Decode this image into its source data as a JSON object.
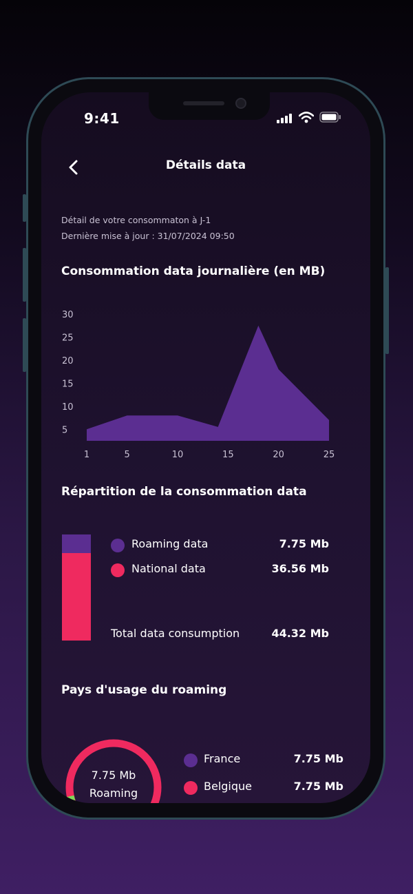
{
  "status_bar": {
    "time": "9:41"
  },
  "header": {
    "title": "Détails data"
  },
  "info": {
    "line1": "Détail de votre consommaton à J-1",
    "line2": "Dernière mise à jour : 31/07/2024 09:50"
  },
  "daily_section": {
    "title": "Consommation data journalière (en MB)"
  },
  "chart_data": {
    "type": "area",
    "title": "Consommation data journalière (en MB)",
    "x": [
      1,
      5,
      10,
      14,
      18,
      20,
      25
    ],
    "values": [
      5,
      8,
      8,
      5.5,
      27.5,
      18,
      7
    ],
    "xticks": [
      "1",
      "5",
      "10",
      "15",
      "20",
      "25"
    ],
    "yticks": [
      "30",
      "25",
      "20",
      "15",
      "10",
      "5"
    ],
    "ylim": [
      2.5,
      30
    ],
    "xlim": [
      1,
      25
    ],
    "color": "#5b2e91",
    "grid": false
  },
  "repartition": {
    "title": "Répartition de la consommation data",
    "items": [
      {
        "label": "Roaming data",
        "value": "7.75 Mb",
        "color": "#5b2e91"
      },
      {
        "label": "National data",
        "value": "36.56  Mb",
        "color": "#ef2a5f"
      }
    ],
    "total_label": "Total data consumption",
    "total_value": "44.32 Mb",
    "bar_fractions": {
      "roaming": 0.175,
      "national": 0.825
    }
  },
  "roaming_countries": {
    "title": "Pays d'usage du roaming",
    "donut_value": "7.75 Mb",
    "donut_label": "Roaming",
    "items": [
      {
        "label": "France",
        "value": "7.75 Mb",
        "color": "#5b2e91"
      },
      {
        "label": "Belgique",
        "value": "7.75 Mb",
        "color": "#ef2a5f"
      }
    ],
    "colors": {
      "main": "#ef2a5f",
      "secondary": "#5b2e91",
      "accent": "#7ed957"
    }
  }
}
